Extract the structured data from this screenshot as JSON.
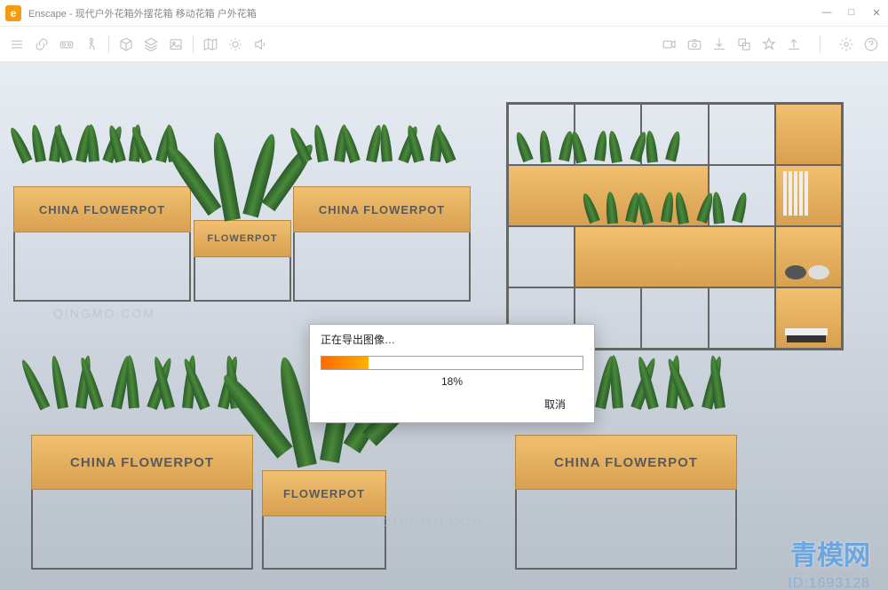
{
  "window": {
    "app": "Enscape",
    "title": "Enscape - 现代户外花箱外摆花箱 移动花箱 户外花箱",
    "controls": {
      "min": "—",
      "max": "□",
      "close": "✕"
    }
  },
  "toolbar": {
    "left": [
      {
        "name": "menu-icon",
        "glyph": "menu"
      },
      {
        "name": "link-icon",
        "glyph": "link"
      },
      {
        "name": "vr-icon",
        "glyph": "vr"
      },
      {
        "name": "walk-icon",
        "glyph": "walk"
      }
    ],
    "mid1": [
      {
        "name": "box-icon",
        "glyph": "cube"
      },
      {
        "name": "layers-icon",
        "glyph": "layers"
      },
      {
        "name": "image-icon",
        "glyph": "image"
      }
    ],
    "mid2": [
      {
        "name": "map-icon",
        "glyph": "map"
      },
      {
        "name": "sun-icon",
        "glyph": "sun"
      },
      {
        "name": "speaker-icon",
        "glyph": "speaker"
      }
    ],
    "right": [
      {
        "name": "video-icon",
        "glyph": "video"
      },
      {
        "name": "screenshot-icon",
        "glyph": "camera"
      },
      {
        "name": "export-icon",
        "glyph": "export"
      },
      {
        "name": "batch-icon",
        "glyph": "batch"
      },
      {
        "name": "favorite-icon",
        "glyph": "star"
      },
      {
        "name": "upload-icon",
        "glyph": "upload"
      },
      {
        "name": "settings-icon",
        "glyph": "settings"
      },
      {
        "name": "help-icon",
        "glyph": "help"
      }
    ]
  },
  "scene": {
    "planter_label_large": "CHINA FLOWERPOT",
    "planter_label_small": "FLOWERPOT"
  },
  "dialog": {
    "title": "正在导出图像…",
    "percent_value": 18,
    "percent_text": "18%",
    "cancel": "取消"
  },
  "watermarks": {
    "faint": "QINGMO.COM",
    "logo": "青模网",
    "id": "ID:1693128"
  }
}
